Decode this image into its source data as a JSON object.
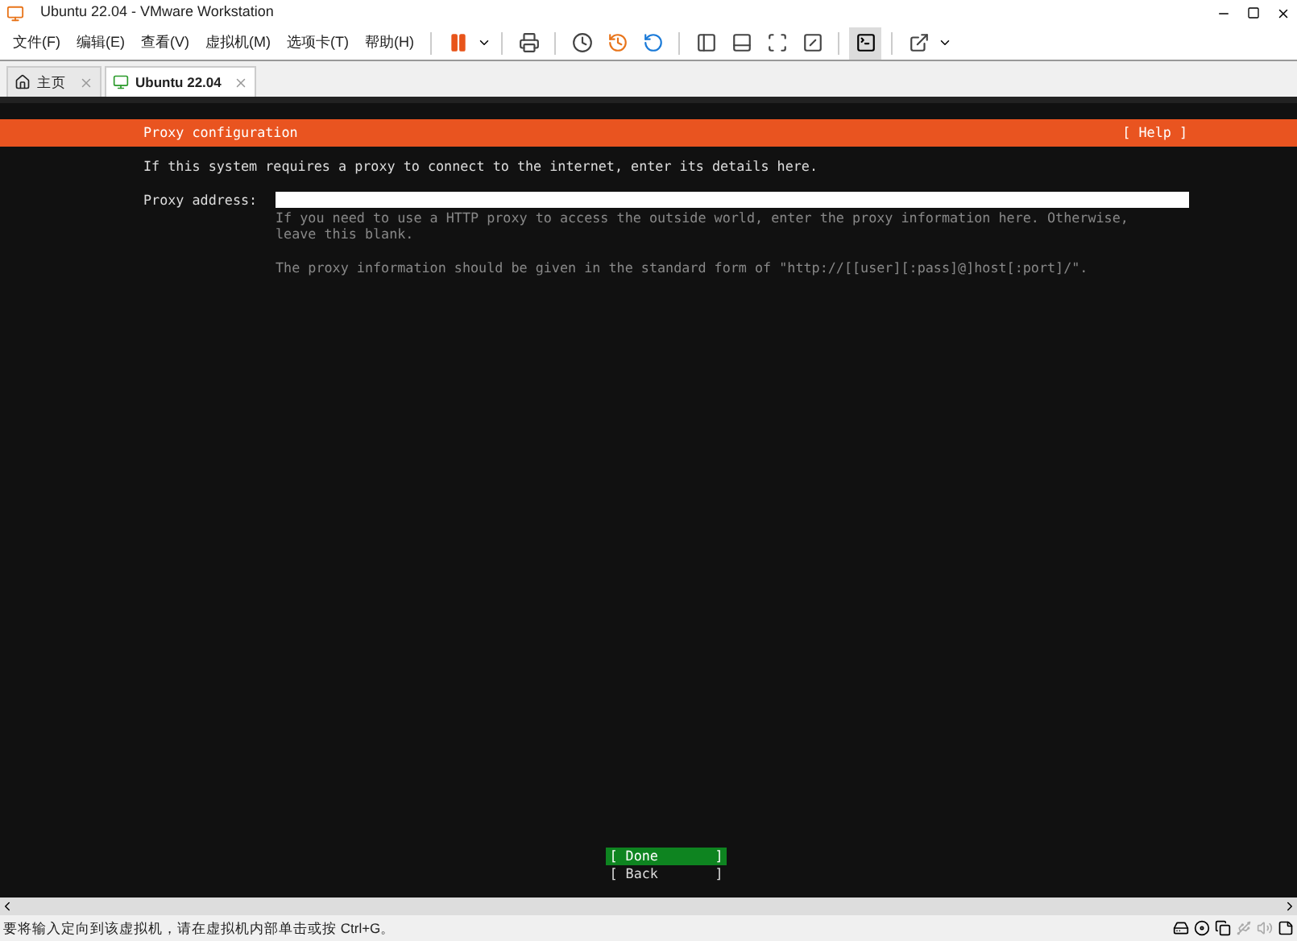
{
  "window": {
    "title": "Ubuntu 22.04 - VMware Workstation"
  },
  "menu": [
    "文件(F)",
    "编辑(E)",
    "查看(V)",
    "虚拟机(M)",
    "选项卡(T)",
    "帮助(H)"
  ],
  "tabs": [
    {
      "label": "主页",
      "selected": false
    },
    {
      "label": "Ubuntu 22.04",
      "selected": true
    }
  ],
  "installer": {
    "title": "Proxy configuration",
    "help": "[ Help ]",
    "intro": "If this system requires a proxy to connect to the internet, enter its details here.",
    "field_label": "Proxy address:",
    "hints": [
      "If you need to use a HTTP proxy to access the outside world, enter the proxy information here. Otherwise, leave this blank.",
      "The proxy information should be given in the standard form of \"http://[[user][:pass]@]host[:port]/\"."
    ],
    "buttons": [
      {
        "label": "[ Done       ]",
        "selected": true
      },
      {
        "label": "[ Back       ]",
        "selected": false
      }
    ]
  },
  "status_bar": {
    "text": "要将输入定向到该虚拟机，请在虚拟机内部单击或按 Ctrl+G。"
  }
}
